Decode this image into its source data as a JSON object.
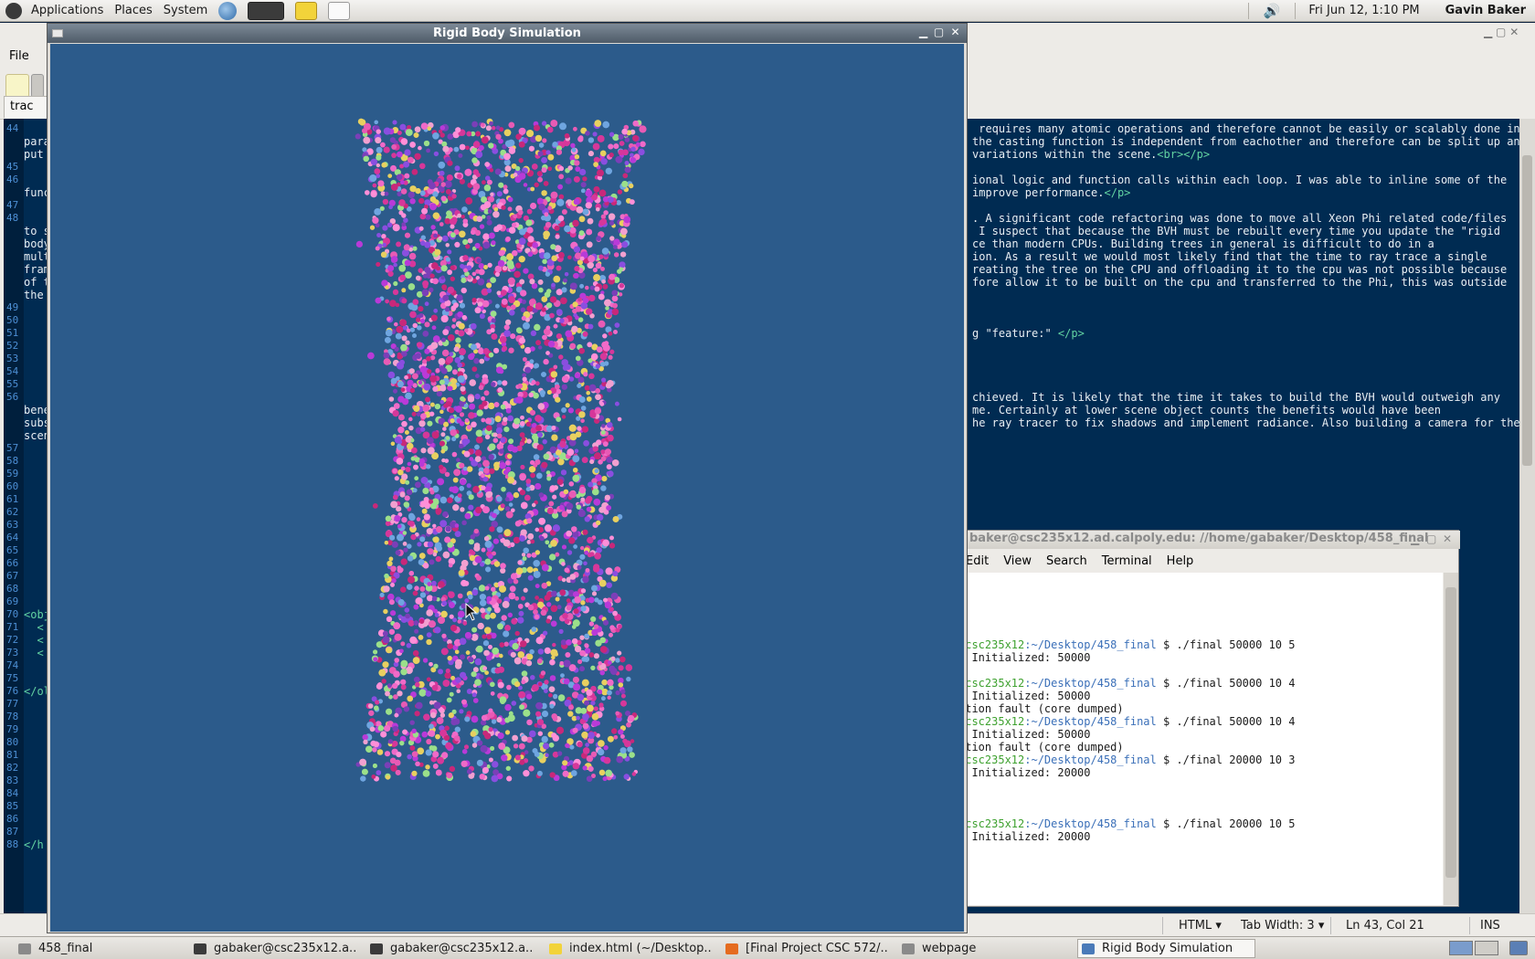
{
  "top_panel": {
    "menus": [
      "Applications",
      "Places",
      "System"
    ],
    "clock": "Fri Jun 12,  1:10 PM",
    "user": "Gavin Baker"
  },
  "editor": {
    "menu_file": "File",
    "tab_label": "trac",
    "left_lines": [
      {
        "n": "44",
        "t": ""
      },
      {
        "n": "",
        "t": "para"
      },
      {
        "n": "",
        "t": "put"
      },
      {
        "n": "45",
        "t": ""
      },
      {
        "n": "46",
        "t": ""
      },
      {
        "n": "",
        "t": "func"
      },
      {
        "n": "47",
        "t": ""
      },
      {
        "n": "48",
        "t": ""
      },
      {
        "n": "",
        "t": "to s"
      },
      {
        "n": "",
        "t": "body"
      },
      {
        "n": "",
        "t": "mult"
      },
      {
        "n": "",
        "t": "fram"
      },
      {
        "n": "",
        "t": "of t"
      },
      {
        "n": "",
        "t": "the"
      },
      {
        "n": "49",
        "t": ""
      },
      {
        "n": "50",
        "t": ""
      },
      {
        "n": "51",
        "t": ""
      },
      {
        "n": "52",
        "t": ""
      },
      {
        "n": "53",
        "t": ""
      },
      {
        "n": "54",
        "t": ""
      },
      {
        "n": "55",
        "t": ""
      },
      {
        "n": "56",
        "t": ""
      },
      {
        "n": "",
        "t": "bene"
      },
      {
        "n": "",
        "t": "subs"
      },
      {
        "n": "",
        "t": "scen"
      },
      {
        "n": "57",
        "t": ""
      },
      {
        "n": "58",
        "t": ""
      },
      {
        "n": "59",
        "t": ""
      },
      {
        "n": "60",
        "t": ""
      },
      {
        "n": "61",
        "t": ""
      },
      {
        "n": "62",
        "t": ""
      },
      {
        "n": "63",
        "t": ""
      },
      {
        "n": "64",
        "t": ""
      },
      {
        "n": "65",
        "t": ""
      },
      {
        "n": "66",
        "t": ""
      },
      {
        "n": "67",
        "t": ""
      },
      {
        "n": "68",
        "t": ""
      },
      {
        "n": "69",
        "t": ""
      },
      {
        "n": "70",
        "t": "<obj"
      },
      {
        "n": "71",
        "t": "  <"
      },
      {
        "n": "72",
        "t": "  <"
      },
      {
        "n": "73",
        "t": "  <"
      },
      {
        "n": "74",
        "t": ""
      },
      {
        "n": "75",
        "t": ""
      },
      {
        "n": "76",
        "t": "</ol"
      },
      {
        "n": "77",
        "t": ""
      },
      {
        "n": "78",
        "t": ""
      },
      {
        "n": "79",
        "t": ""
      },
      {
        "n": "80",
        "t": ""
      },
      {
        "n": "81",
        "t": ""
      },
      {
        "n": "82",
        "t": ""
      },
      {
        "n": "83",
        "t": ""
      },
      {
        "n": "84",
        "t": ""
      },
      {
        "n": "85",
        "t": ""
      },
      {
        "n": "86",
        "t": ""
      },
      {
        "n": "87",
        "t": ""
      },
      {
        "n": "88",
        "t": "</h"
      }
    ],
    "right_lines": [
      {
        "row": 0,
        "text": " requires many atomic operations and therefore cannot be easily or scalably done in"
      },
      {
        "row": 1,
        "text": "the casting function is independent from eachother and therefore can be split up and"
      },
      {
        "row": 2,
        "text": "variations within the scene.",
        "tag": "<br></p>"
      },
      {
        "row": 4,
        "text": "ional logic and function calls within each loop. I was able to inline some of the"
      },
      {
        "row": 5,
        "text": "improve performance.",
        "tag": "</p>"
      },
      {
        "row": 7,
        "text": ". A significant code refactoring was done to move all Xeon Phi related code/files"
      },
      {
        "row": 8,
        "text": " I suspect that because the BVH must be rebuilt every time you update the \"rigid"
      },
      {
        "row": 9,
        "text": "ce than modern CPUs. Building trees in general is difficult to do in a"
      },
      {
        "row": 10,
        "text": "ion. As a result we would most likely find that the time to ray trace a single"
      },
      {
        "row": 11,
        "text": "reating the tree on the CPU and offloading it to the cpu was not possible because"
      },
      {
        "row": 12,
        "text": "fore allow it to be built on the cpu and transferred to the Phi, this was outside"
      },
      {
        "row": 16,
        "text": "g \"feature:\" ",
        "tag": "</p>"
      },
      {
        "row": 21,
        "text": "chieved. It is likely that the time it takes to build the BVH would outweigh any"
      },
      {
        "row": 22,
        "text": "me. Certainly at lower scene object counts the benefits would have been"
      },
      {
        "row": 23,
        "text": "he ray tracer to fix shadows and implement radiance. Also building a camera for the"
      }
    ],
    "status": {
      "language": "HTML",
      "tab_width": "Tab Width:  3",
      "position": "Ln 43, Col 21",
      "mode": "INS"
    }
  },
  "terminal": {
    "title": "baker@csc235x12.ad.calpoly.edu: //home/gabaker/Desktop/458_final",
    "menus": [
      "Edit",
      "View",
      "Search",
      "Terminal",
      "Help"
    ],
    "lines": [
      {
        "row": 5,
        "host": "@csc235x12",
        "path": ":~/Desktop/458_final",
        "cmd": " $ ./final 50000 10 5"
      },
      {
        "row": 6,
        "text": "s Initialized: 50000"
      },
      {
        "row": 8,
        "host": "@csc235x12",
        "path": ":~/Desktop/458_final",
        "cmd": " $ ./final 50000 10 4"
      },
      {
        "row": 9,
        "text": "s Initialized: 50000"
      },
      {
        "row": 10,
        "text": "ation fault (core dumped)"
      },
      {
        "row": 11,
        "host": "@csc235x12",
        "path": ":~/Desktop/458_final",
        "cmd": " $ ./final 50000 10 4"
      },
      {
        "row": 12,
        "text": "s Initialized: 50000"
      },
      {
        "row": 13,
        "text": "ation fault (core dumped)"
      },
      {
        "row": 14,
        "host": "@csc235x12",
        "path": ":~/Desktop/458_final",
        "cmd": " $ ./final 20000 10 3"
      },
      {
        "row": 15,
        "text": "s Initialized: 20000"
      },
      {
        "row": 19,
        "host": "@csc235x12",
        "path": ":~/Desktop/458_final",
        "cmd": " $ ./final 20000 10 5"
      },
      {
        "row": 20,
        "text": "s Initialized: 20000"
      }
    ]
  },
  "simulation": {
    "title": "Rigid Body Simulation",
    "background_color": "#2c5b8b",
    "particle_palette": [
      "#d6379a",
      "#b93ad8",
      "#e85bb5",
      "#8a4ee0",
      "#f06ac8",
      "#c8287a",
      "#6fa5e0",
      "#f2a0d0",
      "#9be08a",
      "#e8d060",
      "#7b3fb8",
      "#ff8fd8"
    ]
  },
  "taskbar": {
    "tasks": [
      {
        "label": "458_final",
        "icon": "folder-icon",
        "active": false
      },
      {
        "label": "gabaker@csc235x12.a...",
        "icon": "terminal-icon",
        "active": false
      },
      {
        "label": "gabaker@csc235x12.a...",
        "icon": "terminal-icon",
        "active": false
      },
      {
        "label": "index.html (~/Desktop...",
        "icon": "text-editor-icon",
        "active": false
      },
      {
        "label": "[Final Project CSC 572/...",
        "icon": "firefox-icon",
        "active": false
      },
      {
        "label": "webpage",
        "icon": "folder-icon",
        "active": false
      },
      {
        "label": "Rigid Body Simulation",
        "icon": "window-icon",
        "active": true
      }
    ]
  }
}
